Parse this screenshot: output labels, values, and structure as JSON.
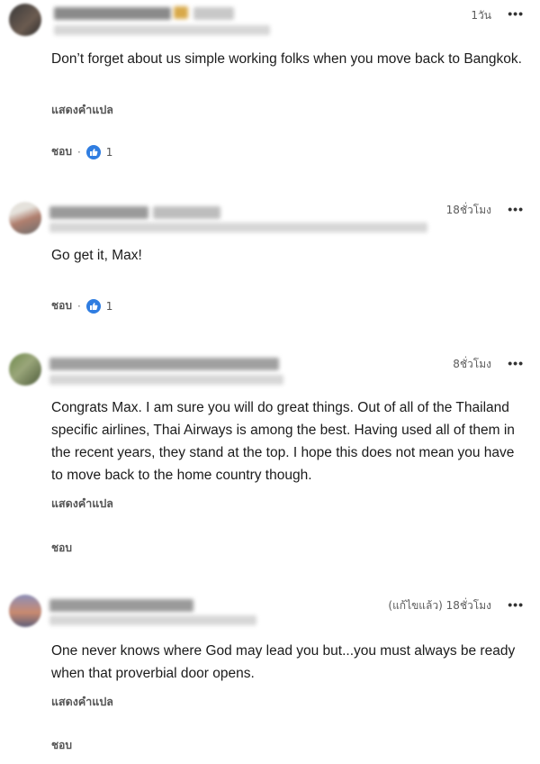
{
  "comments": [
    {
      "time": "1วัน",
      "more": "•••",
      "text": "Don’t forget about us simple working folks when you move back to Bangkok.",
      "translate": "แสดงคำแปล",
      "like_label": "ชอบ",
      "separator": "·",
      "reaction_count": "1"
    },
    {
      "time": "18ชั่วโมง",
      "more": "•••",
      "text": "Go get it, Max!",
      "like_label": "ชอบ",
      "separator": "·",
      "reaction_count": "1"
    },
    {
      "time": "8ชั่วโมง",
      "more": "•••",
      "text": "Congrats Max. I am sure you will do great things. Out of all of the Thailand specific airlines, Thai Airways is among the best. Having used all of them in the recent years, they stand at the top. I hope this does not mean you have to move back to the home country though.",
      "translate": "แสดงคำแปล",
      "like_label": "ชอบ"
    },
    {
      "time": "(แก้ไขแล้ว) 18ชั่วโมง",
      "more": "•••",
      "text": "One never knows where God may lead you but...you must always be ready when that proverbial door opens.",
      "translate": "แสดงคำแปล",
      "like_label": "ชอบ"
    }
  ],
  "colors": {
    "like_blue": "#2f7de1",
    "text": "#1b1b1b",
    "muted": "#555555"
  },
  "icons": {
    "reaction": "thumbs-up-icon",
    "more": "more-options-icon"
  }
}
